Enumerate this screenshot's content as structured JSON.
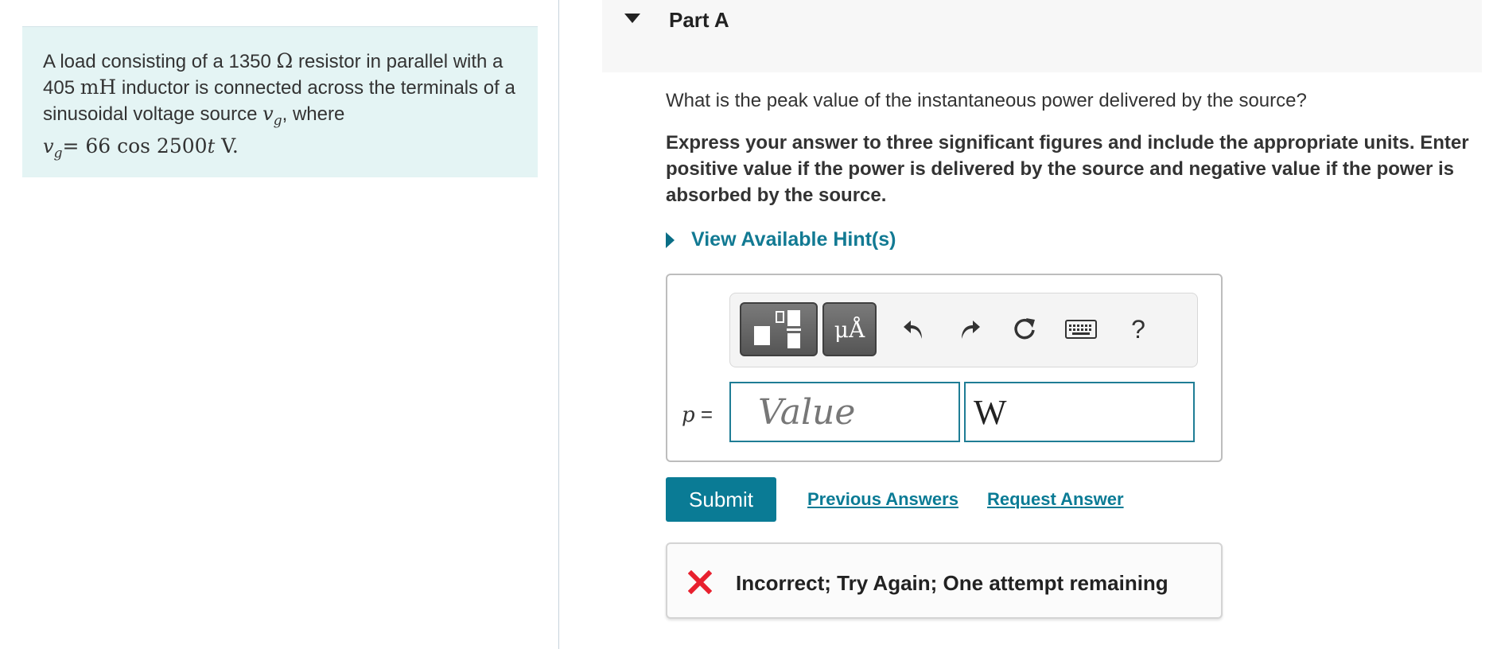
{
  "problem": {
    "intro_1": "A load consisting of a 1350 ",
    "ohm_symbol": "Ω",
    "intro_2": " resistor in parallel with a 405 ",
    "mh": "mH",
    "intro_3": " inductor is connected across the terminals of a sinusoidal voltage source ",
    "vg": "v",
    "vg_sub": "g",
    "intro_4": ", where ",
    "equation": "= 66 cos 2500",
    "eq_t": "t",
    "eq_unit": " V."
  },
  "part": {
    "title": "Part A"
  },
  "question": "What is the peak value of the instantaneous power delivered by the source?",
  "instructions": "Express your answer to three significant figures and include the appropriate units. Enter positive value if the power is delivered by the source and negative value if the power is absorbed by the source.",
  "hint": {
    "label": "View Available Hint(s)"
  },
  "toolbar": {
    "units_label": "μÅ",
    "help_label": "?",
    "icons": [
      "templates-icon",
      "units-icon",
      "undo-icon",
      "redo-icon",
      "reset-icon",
      "keyboard-icon",
      "help-icon"
    ]
  },
  "answer": {
    "var": "p",
    "equals": " =",
    "value_placeholder": "Value",
    "unit_value": "W"
  },
  "actions": {
    "submit": "Submit",
    "previous": "Previous Answers",
    "request": "Request Answer"
  },
  "feedback": {
    "text": "Incorrect; Try Again; One attempt remaining",
    "color": "#e8202e"
  },
  "colors": {
    "accent": "#0a7b95",
    "panel_bg": "#e4f4f4"
  }
}
